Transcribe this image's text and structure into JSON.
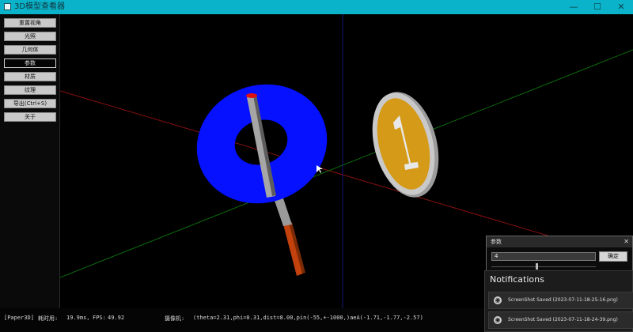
{
  "window": {
    "title": "3D模型查看器",
    "controls": {
      "minimize": "—",
      "maximize": "☐",
      "close": "✕"
    }
  },
  "sidebar": {
    "buttons": [
      {
        "label": "重置视角",
        "active": false
      },
      {
        "label": "光照",
        "active": false
      },
      {
        "label": "几何体",
        "active": false
      },
      {
        "label": "参数",
        "active": true
      },
      {
        "label": "材质",
        "active": false
      },
      {
        "label": "纹理",
        "active": false
      },
      {
        "label": "导出(Ctrl+S)",
        "active": false
      },
      {
        "label": "关于",
        "active": false
      }
    ]
  },
  "scene": {
    "colors": {
      "torus": "#0511ff",
      "coin_gold": "#d9a11a",
      "coin_rim": "#b9b9b9",
      "rod_gray": "#9a9a9a",
      "rod_orange": "#d35400",
      "rod_tip": "#e01010",
      "axis_x": "#8a1010",
      "axis_y": "#0c6a0c",
      "axis_z": "#15157a"
    },
    "coin_numeral": "1"
  },
  "statusbar": {
    "mode": "[Paper3D]",
    "time_label": "耗时用:",
    "time_value": "19.9ms,",
    "fps_label": "FPS:",
    "fps_value": "49.92",
    "camera_label": "摄像机:",
    "camera_value": "(theta=2.31,phi=0.31,dist=8.00,pin(-55,+-1000,)aeA(-1.71,-1.77,-2.57)"
  },
  "param_panel": {
    "title": "参数",
    "close": "✕",
    "input_value": "4",
    "apply_label": "确定",
    "slider_position": 0.43
  },
  "notifications": {
    "title": "Notifications",
    "items": [
      {
        "icon": "camera-icon",
        "text": "ScreenShot Saved   (2023-07-11-18-25-16.png)"
      },
      {
        "icon": "camera-icon",
        "text": "ScreenShot Saved   (2023-07-11-18-24-39.png)"
      }
    ]
  }
}
